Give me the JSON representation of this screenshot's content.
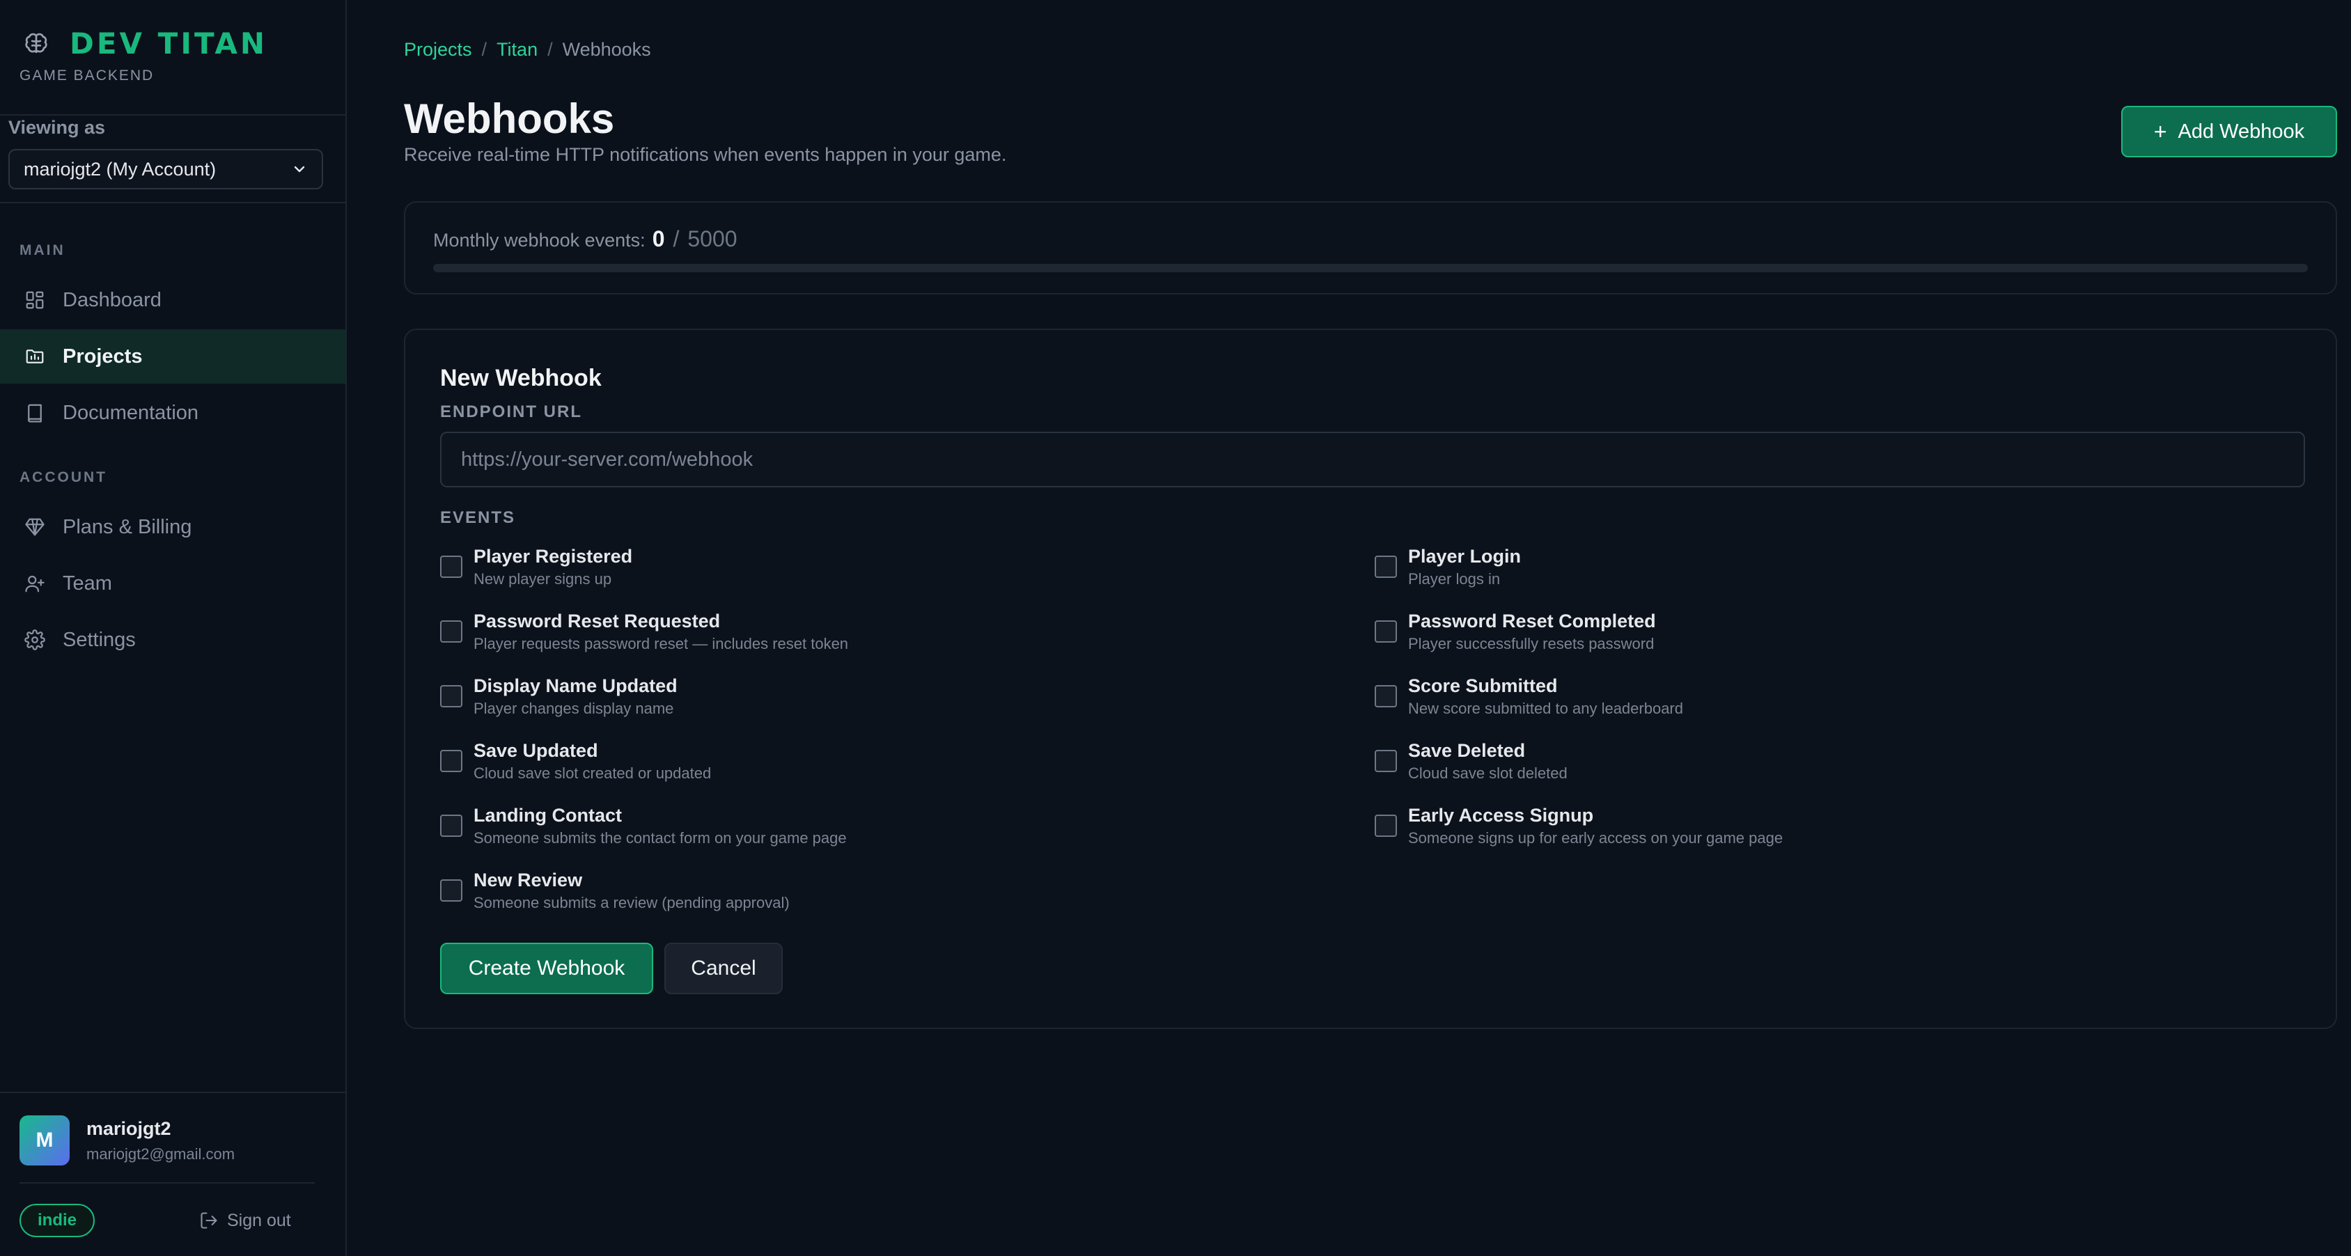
{
  "brand": {
    "name": "DEV TITAN",
    "subtitle": "GAME BACKEND",
    "logo_icon": "brain-icon",
    "accent_color": "#19b97e"
  },
  "viewing": {
    "label": "Viewing as",
    "selected": "mariojgt2 (My Account)"
  },
  "sidebar": {
    "sections": [
      {
        "label": "MAIN",
        "items": [
          {
            "label": "Dashboard",
            "icon": "dashboard-icon",
            "active": false
          },
          {
            "label": "Projects",
            "icon": "folder-icon",
            "active": true
          },
          {
            "label": "Documentation",
            "icon": "book-icon",
            "active": false
          }
        ]
      },
      {
        "label": "ACCOUNT",
        "items": [
          {
            "label": "Plans & Billing",
            "icon": "diamond-icon",
            "active": false
          },
          {
            "label": "Team",
            "icon": "user-plus-icon",
            "active": false
          },
          {
            "label": "Settings",
            "icon": "gear-icon",
            "active": false
          }
        ]
      }
    ]
  },
  "user": {
    "initial": "M",
    "name": "mariojgt2",
    "email": "mariojgt2@gmail.com",
    "plan": "indie",
    "signout_label": "Sign out"
  },
  "breadcrumb": {
    "items": [
      "Projects",
      "Titan"
    ],
    "current": "Webhooks"
  },
  "header": {
    "title": "Webhooks",
    "subtitle": "Receive real-time HTTP notifications when events happen in your game.",
    "add_button": "Add Webhook"
  },
  "usage": {
    "label": "Monthly webhook events:",
    "used": "0",
    "limit": "5000",
    "fraction": 0
  },
  "form": {
    "title": "New Webhook",
    "endpoint_label": "ENDPOINT URL",
    "endpoint_placeholder": "https://your-server.com/webhook",
    "endpoint_value": "",
    "events_label": "EVENTS",
    "events": [
      {
        "name": "Player Registered",
        "desc": "New player signs up",
        "checked": false
      },
      {
        "name": "Player Login",
        "desc": "Player logs in",
        "checked": false
      },
      {
        "name": "Password Reset Requested",
        "desc": "Player requests password reset — includes reset token",
        "checked": false
      },
      {
        "name": "Password Reset Completed",
        "desc": "Player successfully resets password",
        "checked": false
      },
      {
        "name": "Display Name Updated",
        "desc": "Player changes display name",
        "checked": false
      },
      {
        "name": "Score Submitted",
        "desc": "New score submitted to any leaderboard",
        "checked": false
      },
      {
        "name": "Save Updated",
        "desc": "Cloud save slot created or updated",
        "checked": false
      },
      {
        "name": "Save Deleted",
        "desc": "Cloud save slot deleted",
        "checked": false
      },
      {
        "name": "Landing Contact",
        "desc": "Someone submits the contact form on your game page",
        "checked": false
      },
      {
        "name": "Early Access Signup",
        "desc": "Someone signs up for early access on your game page",
        "checked": false
      },
      {
        "name": "New Review",
        "desc": "Someone submits a review (pending approval)",
        "checked": false
      }
    ],
    "create_button": "Create Webhook",
    "cancel_button": "Cancel"
  }
}
